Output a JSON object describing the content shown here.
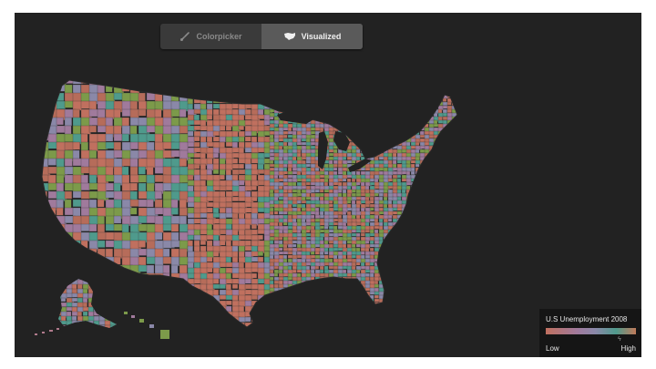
{
  "toolbar": {
    "colorpicker_label": "Colorpicker",
    "visualized_label": "Visualized",
    "colorpicker_icon": "paintbrush-icon",
    "visualized_icon": "us-map-icon",
    "active_tab": "Visualized"
  },
  "legend": {
    "title": "U.S Unemployment 2008",
    "low_label": "Low",
    "high_label": "High"
  },
  "map": {
    "palette": [
      "#c0705f",
      "#a07a9c",
      "#8a88a8",
      "#4f9a8c",
      "#7c9a4a",
      "#b66c5a"
    ],
    "background": "#222222"
  }
}
